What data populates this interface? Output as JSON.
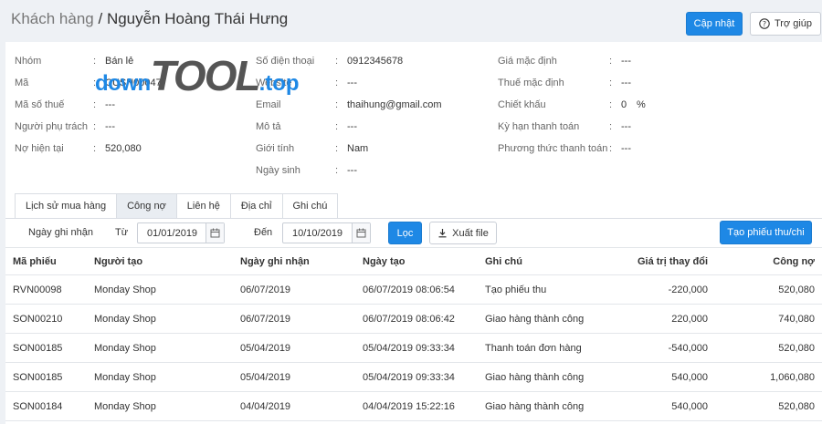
{
  "header": {
    "breadcrumb": "Khách hàng",
    "separator": "/",
    "customer_name": "Nguyễn Hoàng Thái Hưng",
    "update_label": "Cập nhật",
    "help_label": "Trợ giúp"
  },
  "watermark": {
    "part1": "down",
    "part2": "TOOL",
    "part3": ".top"
  },
  "info": {
    "col1": [
      {
        "label": "Nhóm",
        "value": "Bán lẻ"
      },
      {
        "label": "Mã",
        "value": "CUSN00047"
      },
      {
        "label": "Mã số thuế",
        "value": "---"
      },
      {
        "label": "Người phụ trách",
        "value": "---"
      },
      {
        "label": "Nợ hiện tại",
        "value": "520,080"
      }
    ],
    "col2": [
      {
        "label": "Số điện thoại",
        "value": "0912345678"
      },
      {
        "label": "Website",
        "value": "---"
      },
      {
        "label": "Email",
        "value": "thaihung@gmail.com"
      },
      {
        "label": "Mô tả",
        "value": "---"
      },
      {
        "label": "Giới tính",
        "value": "Nam"
      },
      {
        "label": "Ngày sinh",
        "value": "---"
      }
    ],
    "col3": [
      {
        "label": "Giá mặc định",
        "value": "---"
      },
      {
        "label": "Thuế mặc định",
        "value": "---"
      },
      {
        "label": "Chiết khấu",
        "value": "0",
        "unit": "%"
      },
      {
        "label": "Kỳ hạn thanh toán",
        "value": "---"
      },
      {
        "label": "Phương thức thanh toán",
        "value": "---"
      }
    ]
  },
  "tabs": [
    {
      "label": "Lịch sử mua hàng",
      "active": false
    },
    {
      "label": "Công nợ",
      "active": true
    },
    {
      "label": "Liên hệ",
      "active": false
    },
    {
      "label": "Địa chỉ",
      "active": false
    },
    {
      "label": "Ghi chú",
      "active": false
    }
  ],
  "filter": {
    "record_date_label": "Ngày ghi nhận",
    "from_label": "Từ",
    "from_value": "01/01/2019",
    "to_label": "Đến",
    "to_value": "10/10/2019",
    "filter_button": "Lọc",
    "export_button": "Xuất file",
    "create_button": "Tạo phiếu thu/chi"
  },
  "table": {
    "columns": [
      "Mã phiếu",
      "Người tạo",
      "Ngày ghi nhận",
      "Ngày tạo",
      "Ghi chú",
      "Giá trị thay đổi",
      "Công nợ"
    ],
    "rows": [
      [
        "RVN00098",
        "Monday Shop",
        "06/07/2019",
        "06/07/2019 08:06:54",
        "Tạo phiếu thu",
        "-220,000",
        "520,080"
      ],
      [
        "SON00210",
        "Monday Shop",
        "06/07/2019",
        "06/07/2019 08:06:42",
        "Giao hàng thành công",
        "220,000",
        "740,080"
      ],
      [
        "SON00185",
        "Monday Shop",
        "05/04/2019",
        "05/04/2019 09:33:34",
        "Thanh toán đơn hàng",
        "-540,000",
        "520,080"
      ],
      [
        "SON00185",
        "Monday Shop",
        "05/04/2019",
        "05/04/2019 09:33:34",
        "Giao hàng thành công",
        "540,000",
        "1,060,080"
      ],
      [
        "SON00184",
        "Monday Shop",
        "04/04/2019",
        "04/04/2019 15:22:16",
        "Giao hàng thành công",
        "540,000",
        "520,080"
      ]
    ]
  },
  "colors": {
    "primary": "#1e88e5",
    "background": "#eef1f5",
    "tab_active": "#e9edf2"
  }
}
